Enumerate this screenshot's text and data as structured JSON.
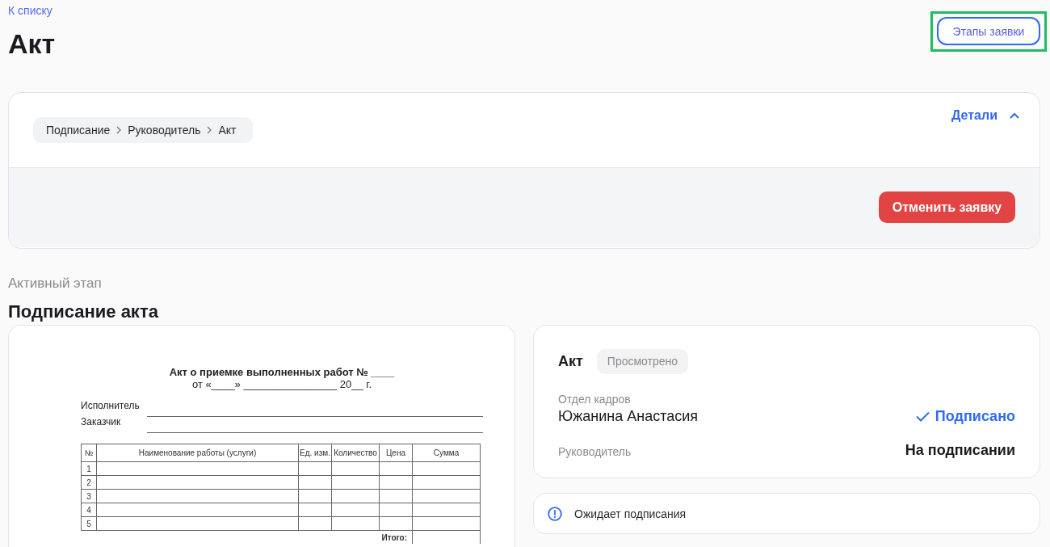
{
  "header": {
    "back_link": "К списку",
    "title": "Акт",
    "stages_button": {
      "label": "Этапы заявки",
      "highlighted": true
    }
  },
  "request": {
    "breadcrumb": [
      "Подписание",
      "Руководитель",
      "Акт"
    ],
    "details_toggle": {
      "label": "Детали",
      "expanded": true
    },
    "cancel_button": "Отменить заявку"
  },
  "active_stage": {
    "label": "Активный этап",
    "title": "Подписание акта",
    "document": {
      "title": "Акт о приемке выполненных работ № ____",
      "date_line": "от «____» ________________ 20__ г.",
      "fields": [
        "Исполнитель",
        "Заказчик"
      ],
      "table": {
        "columns": [
          "№",
          "Наименование работы (услуги)",
          "Ед. изм.",
          "Количество",
          "Цена",
          "Сумма"
        ],
        "rows": [
          {
            "number": "1"
          },
          {
            "number": "2"
          },
          {
            "number": "3"
          },
          {
            "number": "4"
          },
          {
            "number": "5"
          }
        ],
        "total_label": "Итого:"
      }
    },
    "signing": {
      "document_name": "Акт",
      "badge": "Просмотрено",
      "signers": [
        {
          "department": "Отдел кадров",
          "name": "Южанина Анастасия",
          "status": "Подписано",
          "signed": true
        },
        {
          "department": "Руководитель",
          "status": "На подписании",
          "signed": false
        }
      ]
    },
    "notice": "Ожидает подписания"
  }
}
